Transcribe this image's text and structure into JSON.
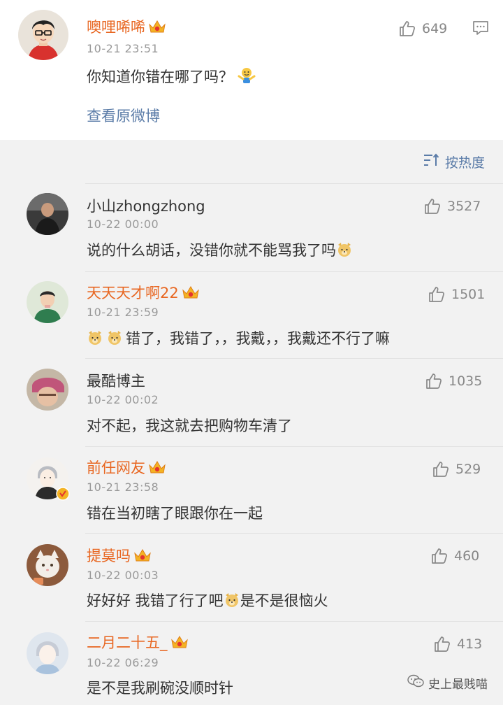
{
  "post": {
    "author": "噢哩唏唏",
    "time": "10-21 23:51",
    "text": "你知道你错在哪了吗？",
    "likes": "649",
    "view_original": "查看原微博"
  },
  "sort_label": "按热度",
  "comments": [
    {
      "name": "小山zhongzhong",
      "time": "10-22 00:00",
      "text": "说的什么胡话，没错你就不能骂我了吗",
      "likes": "3527"
    },
    {
      "name": "天天天才啊22",
      "time": "10-21 23:59",
      "text": "错了，我错了，，我戴，，我戴还不行了嘛",
      "likes": "1501"
    },
    {
      "name": "最酷博主",
      "time": "10-22 00:02",
      "text": "对不起，我这就去把购物车清了",
      "likes": "1035"
    },
    {
      "name": "前任网友",
      "time": "10-21 23:58",
      "text": "错在当初瞎了眼跟你在一起",
      "likes": "529"
    },
    {
      "name": "提莫吗",
      "time": "10-22 00:03",
      "text_a": "好好好 我错了行了吧",
      "text_b": "是不是很恼火",
      "likes": "460"
    },
    {
      "name": "二月二十五_",
      "time": "10-22 06:29",
      "text": "是不是我刷碗没顺时针",
      "likes": "413"
    }
  ],
  "watermark": "史上最贱喵",
  "colors": {
    "vip_name": "#e86722",
    "link": "#5b7ca8",
    "time": "#999999",
    "background": "#f2f2f2"
  },
  "icons": [
    "thumbs-up-icon",
    "comment-icon",
    "crown-badge-icon",
    "doge-emoji-icon",
    "shrug-emoji-icon",
    "sort-icon",
    "wechat-icon"
  ]
}
